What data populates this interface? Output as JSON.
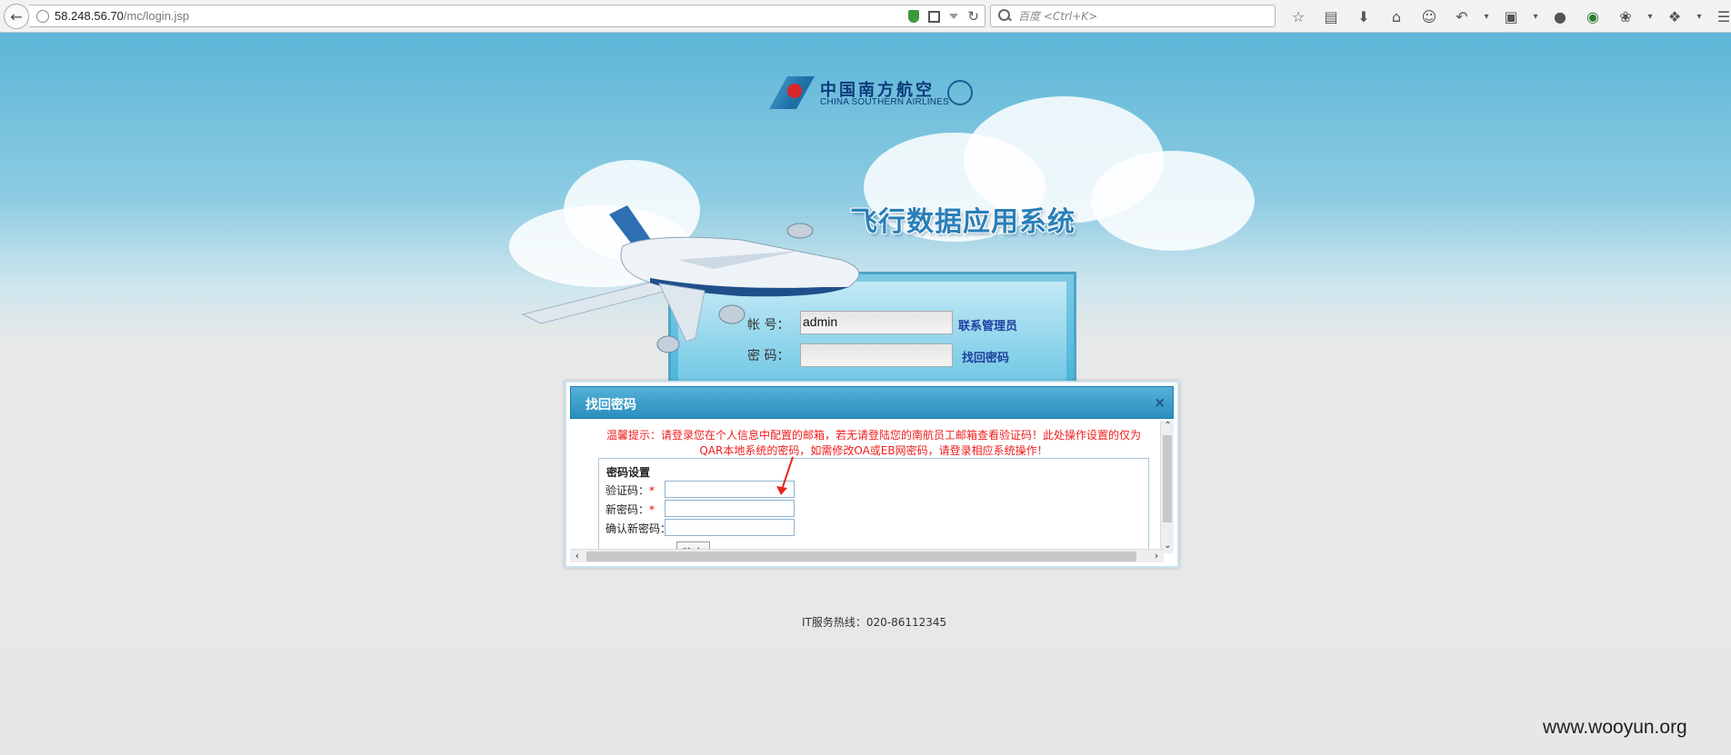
{
  "browser": {
    "url_host": "58.248.56.70",
    "url_path": "/mc/login.jsp",
    "search_placeholder": "百度 <Ctrl+K>"
  },
  "brand": {
    "cn": "中国南方航空",
    "en": "CHINA SOUTHERN AIRLINES"
  },
  "app_title": "飞行数据应用系统",
  "login": {
    "account_label": "帐  号：",
    "account_value": "admin",
    "password_label": "密  码：",
    "contact_admin": "联系管理员",
    "find_password": "找回密码"
  },
  "dialog": {
    "title": "找回密码",
    "close": "×",
    "warning_line1": "温馨提示：请登录您在个人信息中配置的邮箱，若无请登陆您的南航员工邮箱查看验证码！此处操作设置的仅为",
    "warning_line2": "QAR本地系统的密码，如需修改OA或EB网密码，请登录相应系统操作！",
    "legend": "密码设置",
    "fields": [
      {
        "label": "验证码：",
        "required": "*"
      },
      {
        "label": "新密码：",
        "required": "*"
      },
      {
        "label": "确认新密码：",
        "required": "*"
      }
    ],
    "confirm": "确定"
  },
  "hotline": "IT服务热线：020-86112345",
  "watermark": "www.wooyun.org",
  "colors": {
    "dialog_header": "#2a8fbf",
    "warning_text": "#f01c1c",
    "link": "#1f3f9f"
  }
}
